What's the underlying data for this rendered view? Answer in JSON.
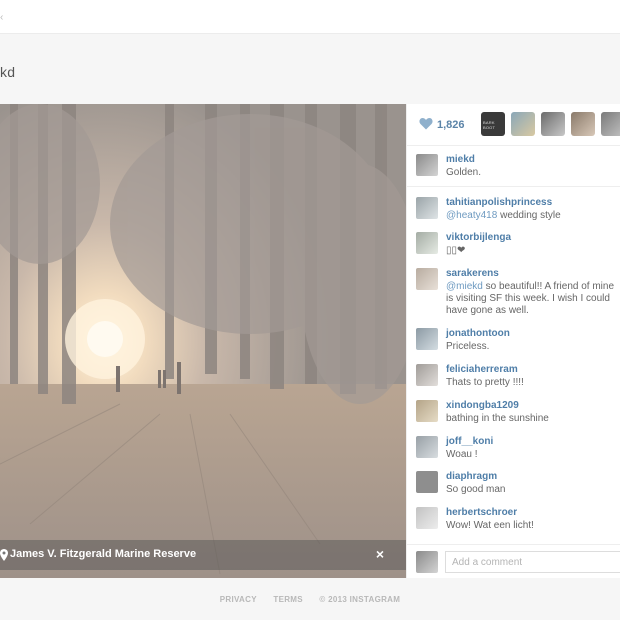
{
  "topbar": {
    "glyph": "‹"
  },
  "profile": {
    "username_partial": "kd"
  },
  "photo": {
    "location": "James V. Fitzgerald Marine Reserve",
    "close_label": "×"
  },
  "likes": {
    "count": "1,826",
    "first_liker_label": "BARK BOOT"
  },
  "comments": [
    {
      "user": "miekd",
      "text": "Golden."
    },
    {
      "user": "tahitianpolishprincess",
      "mention": "@heaty418",
      "text": " wedding style"
    },
    {
      "user": "viktorbijlenga",
      "text": "▯▯❤"
    },
    {
      "user": "sarakerens",
      "mention": "@miekd",
      "text": " so beautiful!! A friend of mine is visiting SF this week. I wish I could have gone as well."
    },
    {
      "user": "jonathontoon",
      "text": "Priceless."
    },
    {
      "user": "feliciaherreram",
      "text": "Thats to pretty !!!!"
    },
    {
      "user": "xindongba1209",
      "text": "bathing in the sunshine"
    },
    {
      "user": "joff__koni",
      "text": "Woau !"
    },
    {
      "user": "diaphragm",
      "text": "So good man"
    },
    {
      "user": "herbertschroer",
      "text": "Wow! Wat een licht!"
    }
  ],
  "add_comment": {
    "placeholder": "Add a comment"
  },
  "footer": {
    "privacy": "PRIVACY",
    "terms": "TERMS",
    "copyright": "© 2013 INSTAGRAM"
  },
  "icons": {
    "heart": "heart-icon",
    "location": "location-pin-icon",
    "close": "close-icon"
  },
  "colors": {
    "link_blue": "#4f7ea8",
    "like_blue": "#5b84a8",
    "mention_blue": "#6e9ac0"
  }
}
